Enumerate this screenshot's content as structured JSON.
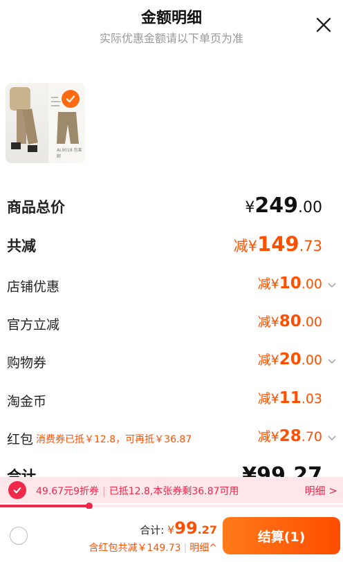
{
  "header": {
    "title": "金额明细",
    "subtitle": "实际优惠金额请以下单页为准"
  },
  "product": {
    "image_tag": "AL9018 包某邮"
  },
  "rows": {
    "total_price": {
      "label": "商品总价",
      "prefix": "¥",
      "int": "249",
      "dec": ".00"
    },
    "total_reduce": {
      "label": "共减",
      "prefix": "减¥",
      "int": "149",
      "dec": ".73"
    },
    "shop_discount": {
      "label": "店铺优惠",
      "prefix": "减¥",
      "int": "10",
      "dec": ".00"
    },
    "official_reduce": {
      "label": "官方立减",
      "prefix": "减¥",
      "int": "80",
      "dec": ".00"
    },
    "shopping_coupon": {
      "label": "购物券",
      "prefix": "减¥",
      "int": "20",
      "dec": ".00"
    },
    "taojinbi": {
      "label": "淘金币",
      "prefix": "减¥",
      "int": "11",
      "dec": ".03"
    },
    "hongbao": {
      "label": "红包",
      "note": "消费券已抵￥12.8，可再抵￥36.87",
      "prefix": "减¥",
      "int": "28",
      "dec": ".70"
    },
    "partial_total": {
      "label": "合计",
      "value": "¥99.27"
    }
  },
  "coupon_bar": {
    "left_text": "49.67元9折券",
    "right_text": "已抵12.8,本张券剩36.87可用",
    "detail_label": "明细 >",
    "progress": 0.26
  },
  "footer": {
    "sum_label": "合计: ",
    "sum_prefix": "¥",
    "sum_int": "99",
    "sum_dec": ".27",
    "sub_text": "含红包共减￥149.73",
    "detail_label": "明细^",
    "checkout_label": "结算(1)"
  },
  "colors": {
    "accent": "#ff5000",
    "coupon_red": "#f0284a",
    "coupon_bg": "#fde7ea"
  }
}
